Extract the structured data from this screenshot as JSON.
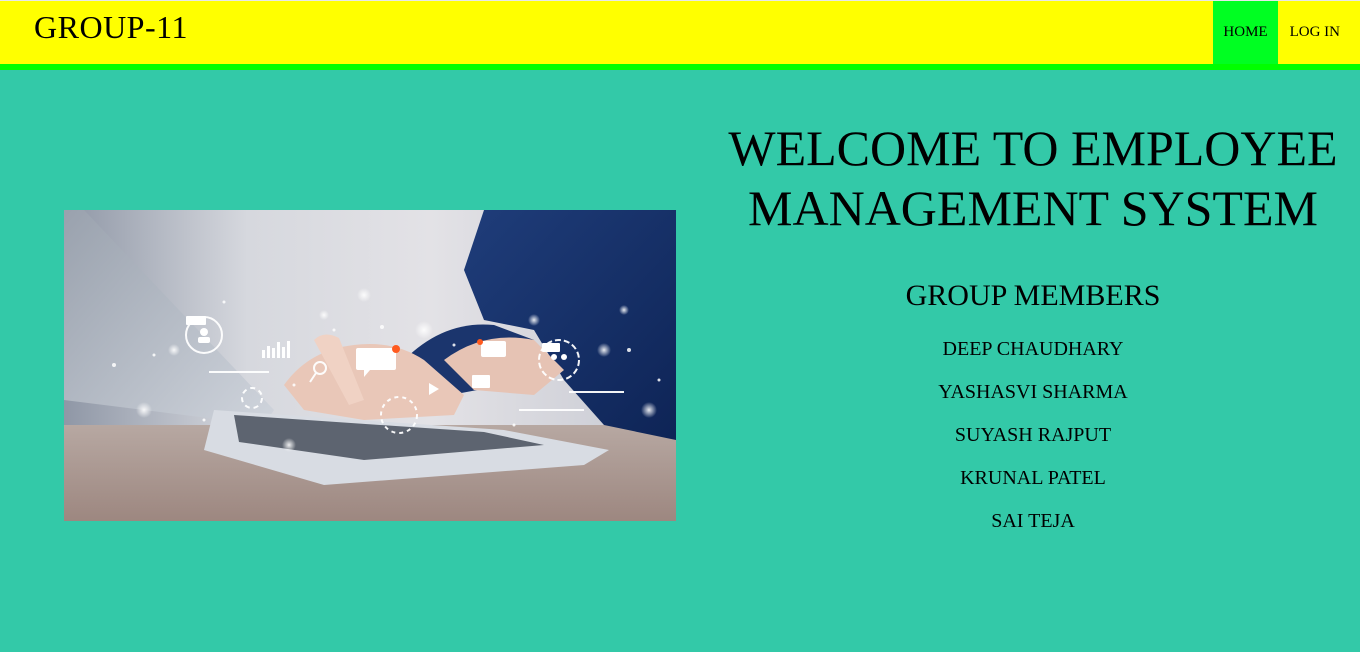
{
  "nav": {
    "brand": "GROUP-11",
    "links": [
      {
        "label": "HOME",
        "active": true
      },
      {
        "label": "LOG IN",
        "active": false
      }
    ],
    "bar_color": "#ffff00",
    "active_color": "#00ff22",
    "underline_color": "#00ff00"
  },
  "main": {
    "background_color": "#33c9a8",
    "hero_image": "laptop-typing-digital-icons-image",
    "welcome_title": "WELCOME TO EMPLOYEE MANAGEMENT SYSTEM",
    "members_heading": "GROUP MEMBERS",
    "members": [
      "DEEP CHAUDHARY",
      "YASHASVI SHARMA",
      "SUYASH RAJPUT",
      "KRUNAL PATEL",
      "SAI TEJA"
    ]
  }
}
